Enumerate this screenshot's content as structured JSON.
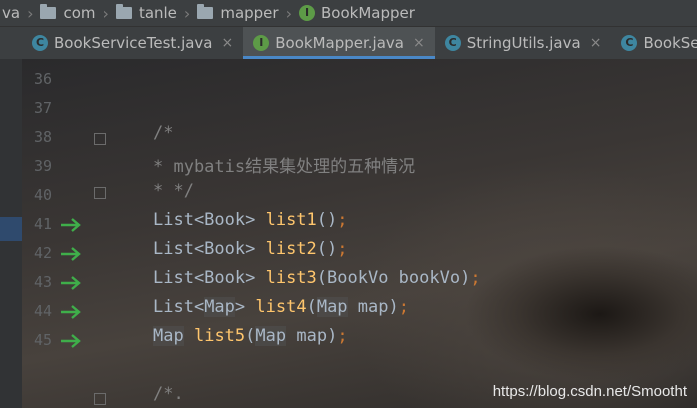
{
  "breadcrumb": {
    "items": [
      "va",
      "com",
      "tanle",
      "mapper",
      "BookMapper"
    ]
  },
  "tabs": [
    {
      "label": "BookServiceTest.java",
      "icon": "class-icon",
      "active": false,
      "close": "×"
    },
    {
      "label": "BookMapper.java",
      "icon": "interface-icon",
      "active": true,
      "close": "×"
    },
    {
      "label": "StringUtils.java",
      "icon": "class-icon",
      "active": false,
      "close": "×"
    },
    {
      "label": "BookServ",
      "icon": "class-icon",
      "active": false,
      "close": ""
    }
  ],
  "gutter": {
    "line_numbers": [
      "36",
      "37",
      "38",
      "39",
      "40",
      "41",
      "42",
      "43",
      "44",
      "45"
    ]
  },
  "code": {
    "line38": "/*",
    "line39_prefix": "* mybatis",
    "line39_text": "结果集处理的五种情况",
    "line40": "* */",
    "line41_type": "List<Book> ",
    "line41_method": "list1",
    "line41_rest": "()",
    "line41_semi": ";",
    "line42_type": "List<Book> ",
    "line42_method": "list2",
    "line42_rest": "()",
    "line42_semi": ";",
    "line43_type": "List<Book> ",
    "line43_method": "list3",
    "line43_rest": "(BookVo bookVo)",
    "line43_semi": ";",
    "line44_type_a": "List<",
    "line44_type_b": "Map",
    "line44_type_c": "> ",
    "line44_method": "list4",
    "line44_rest_a": "(",
    "line44_rest_b": "Map",
    "line44_rest_c": " map)",
    "line44_semi": ";",
    "line45_type": "Map",
    "line45_method": "list5",
    "line45_rest_a": "(",
    "line45_rest_b": "Map",
    "line45_rest_c": " map)",
    "line45_semi": ";",
    "line47": "/*."
  },
  "watermark": "https://blog.csdn.net/Smootht",
  "colors": {
    "comment": "#808080",
    "method": "#ffc66d",
    "keyword": "#cc7832",
    "text": "#a9b7c6",
    "gutter_arrow": "#3fae4a"
  }
}
